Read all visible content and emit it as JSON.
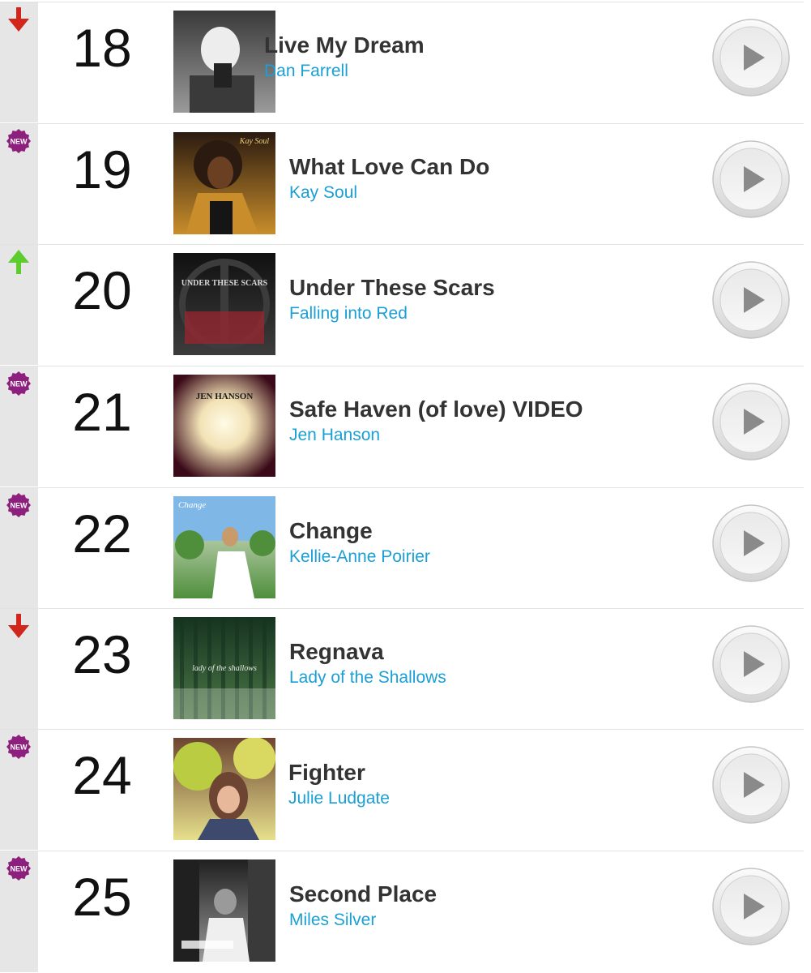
{
  "chart": {
    "entries": [
      {
        "rank": "18",
        "title": "Live My Dream",
        "artist": "Dan Farrell",
        "movement": "down",
        "art": {
          "style": "bw-portrait",
          "text": "",
          "colors": [
            "#3a3a3a",
            "#9a9a9a",
            "#ededed"
          ]
        }
      },
      {
        "rank": "19",
        "title": "What Love Can Do",
        "artist": "Kay Soul",
        "movement": "new",
        "art": {
          "style": "gold-portrait",
          "text": "Kay Soul",
          "colors": [
            "#2a1a10",
            "#c98e2b",
            "#f0cf72"
          ]
        }
      },
      {
        "rank": "20",
        "title": "Under These Scars",
        "artist": "Falling into Red",
        "movement": "up",
        "art": {
          "style": "dark-text",
          "text": "UNDER THESE SCARS",
          "colors": [
            "#111111",
            "#3c3c3c",
            "#9a2630"
          ]
        }
      },
      {
        "rank": "21",
        "title": "Safe Haven (of love) VIDEO",
        "artist": "Jen Hanson",
        "movement": "new",
        "art": {
          "style": "glow",
          "text": "JEN HANSON",
          "colors": [
            "#3a0a18",
            "#f2e2b6",
            "#fffbe6"
          ]
        }
      },
      {
        "rank": "22",
        "title": "Change",
        "artist": "Kellie-Anne Poirier",
        "movement": "new",
        "art": {
          "style": "summer",
          "text": "Change",
          "colors": [
            "#7fb8e6",
            "#4f8f3c",
            "#f1eee6"
          ]
        }
      },
      {
        "rank": "23",
        "title": "Regnava",
        "artist": "Lady of the Shallows",
        "movement": "down",
        "art": {
          "style": "forest",
          "text": "lady of the shallows",
          "colors": [
            "#163420",
            "#4d7748",
            "#cfd8c8"
          ]
        }
      },
      {
        "rank": "24",
        "title": "Fighter",
        "artist": "Julie Ludgate",
        "movement": "new",
        "art": {
          "style": "garden",
          "text": "",
          "colors": [
            "#b9cc42",
            "#e6e08c",
            "#6d4532"
          ]
        }
      },
      {
        "rank": "25",
        "title": "Second Place",
        "artist": "Miles Silver",
        "movement": "new",
        "art": {
          "style": "mono",
          "text": "",
          "colors": [
            "#202020",
            "#9a9a9a",
            "#efefef"
          ]
        }
      }
    ]
  },
  "badges": {
    "new_label": "NEW"
  },
  "icons": {
    "down": "arrow-down-icon",
    "up": "arrow-up-icon",
    "new": "new-badge-icon",
    "play": "play-icon"
  },
  "colors": {
    "down_arrow": "#d0261c",
    "up_arrow": "#5ccc2e",
    "new_badge": "#8d1f7d",
    "artist_link": "#1a9fd6",
    "title": "#333333",
    "play_arrow": "#8a8a8a"
  }
}
